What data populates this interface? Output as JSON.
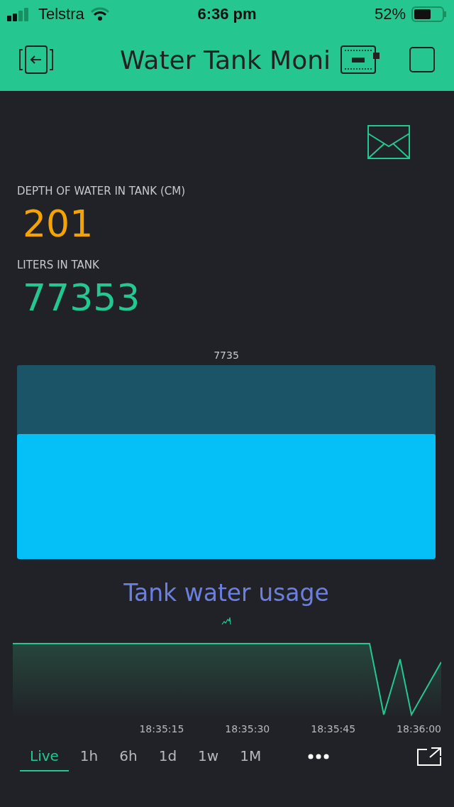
{
  "status_bar": {
    "carrier": "Telstra",
    "time": "6:36 pm",
    "battery": "52%"
  },
  "header": {
    "title": "Water Tank Moni"
  },
  "displays": [
    {
      "label": "DEPTH  OF WATER IN TANK (CM)",
      "value": "201",
      "color": "#f5a300"
    },
    {
      "label": "LITERS IN TANK",
      "value": "77353",
      "color": "#23c890"
    }
  ],
  "level_bar": {
    "reading": "7735"
  },
  "chart": {
    "title": "Tank water usage",
    "x_labels": [
      "18:35:15",
      "18:35:30",
      "18:35:45",
      "18:36:00"
    ]
  },
  "periods": [
    {
      "label": "Live",
      "selected": true
    },
    {
      "label": "1h",
      "selected": false
    },
    {
      "label": "6h",
      "selected": false
    },
    {
      "label": "1d",
      "selected": false
    },
    {
      "label": "1w",
      "selected": false
    },
    {
      "label": "1M",
      "selected": false
    }
  ]
}
